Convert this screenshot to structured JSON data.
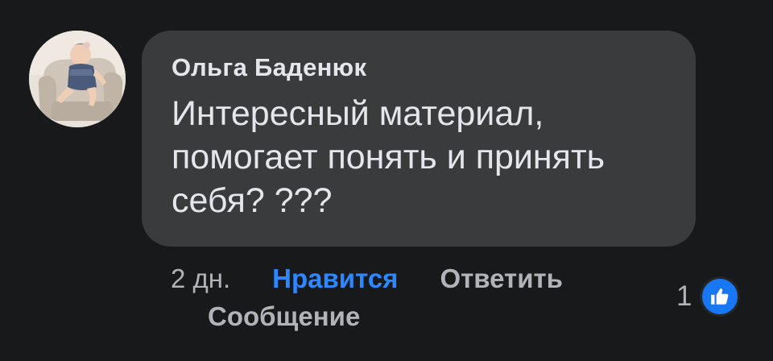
{
  "comment": {
    "author": "Ольга Баденюк",
    "text": "Интересный материал, помогает понять и принять себя? ???",
    "avatar_icon": "user-avatar-photo"
  },
  "actions": {
    "time": "2 дн.",
    "like_label": "Нравится",
    "reply_label": "Ответить",
    "message_label": "Сообщение"
  },
  "reactions": {
    "count": "1",
    "icon": "thumbs-up-icon",
    "color": "#1877f2"
  },
  "colors": {
    "background": "#18191a",
    "bubble": "#3a3b3c",
    "text_primary": "#e4e6eb",
    "text_secondary": "#b0b3b8",
    "accent": "#2d88ff"
  }
}
